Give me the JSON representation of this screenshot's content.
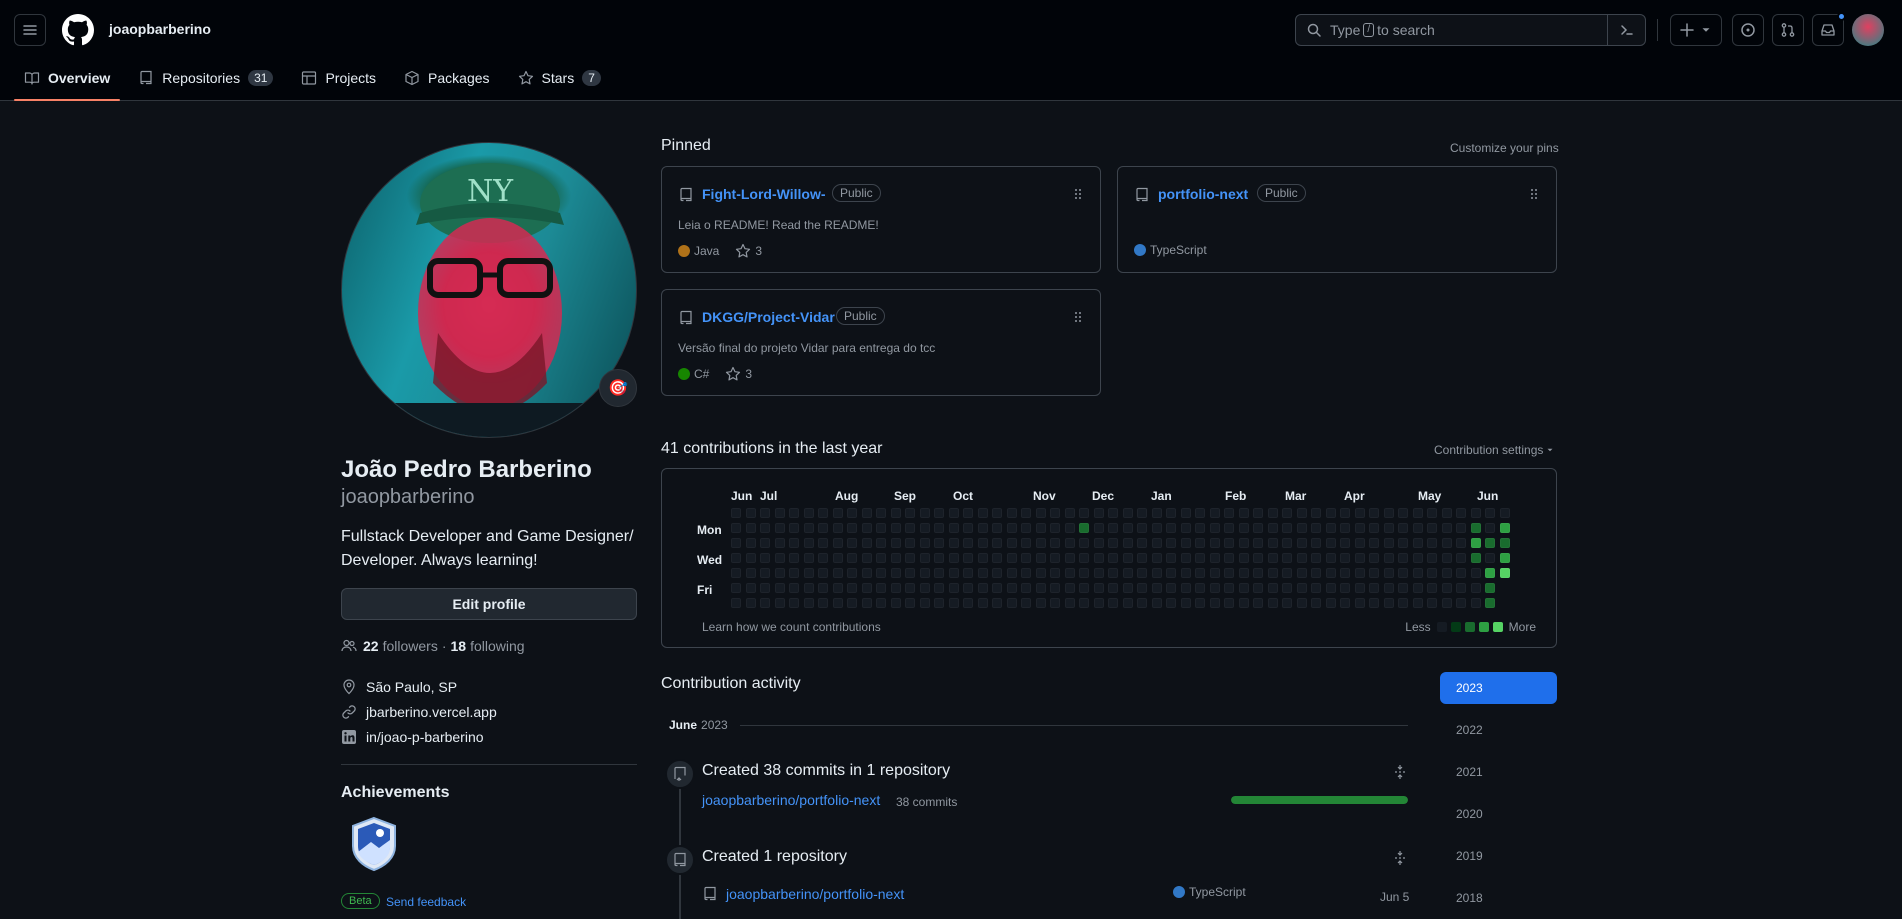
{
  "header": {
    "username": "joaopbarberino",
    "search_before": "Type",
    "search_key": "/",
    "search_after": "to search"
  },
  "tabs": [
    {
      "label": "Overview",
      "icon": "book-icon",
      "active": true
    },
    {
      "label": "Repositories",
      "count": "31",
      "icon": "repo-icon"
    },
    {
      "label": "Projects",
      "icon": "table-icon"
    },
    {
      "label": "Packages",
      "icon": "package-icon"
    },
    {
      "label": "Stars",
      "count": "7",
      "icon": "star-icon"
    }
  ],
  "profile": {
    "name": "João Pedro Barberino",
    "login": "joaopbarberino",
    "bio": "Fullstack Developer and Game Designer/ Developer. Always learning!",
    "edit_label": "Edit profile",
    "followers": "22",
    "followers_label": "followers",
    "sep": "·",
    "following": "18",
    "following_label": "following",
    "location": "São Paulo, SP",
    "website": "jbarberino.vercel.app",
    "linkedin": "in/joao-p-barberino",
    "status_emoji": "🎯"
  },
  "achievements": {
    "title": "Achievements",
    "beta": "Beta",
    "feedback": "Send feedback"
  },
  "pinned": {
    "title": "Pinned",
    "customize": "Customize your pins",
    "repos": [
      {
        "name": "Fight-Lord-Willow-",
        "visibility": "Public",
        "description": "Leia o README! Read the README!",
        "language": "Java",
        "lang_color": "#b07219",
        "stars": "3"
      },
      {
        "name": "portfolio-next",
        "visibility": "Public",
        "description": "",
        "language": "TypeScript",
        "lang_color": "#3178c6",
        "stars": ""
      },
      {
        "name": "DKGG/Project-Vidar",
        "visibility": "Public",
        "description": "Versão final do projeto Vidar para entrega do tcc",
        "language": "C#",
        "lang_color": "#178600",
        "stars": "3"
      }
    ]
  },
  "contributions": {
    "title": "41 contributions in the last year",
    "settings": "Contribution settings",
    "months": [
      "Jun",
      "Jul",
      "Aug",
      "Sep",
      "Oct",
      "Nov",
      "Dec",
      "Jan",
      "Feb",
      "Mar",
      "Apr",
      "May",
      "Jun"
    ],
    "days": [
      "Mon",
      "Wed",
      "Fri"
    ],
    "learn": "Learn how we count contributions",
    "less": "Less",
    "more": "More",
    "levels": [
      "#151b23",
      "#033a16",
      "#196c2e",
      "#2ea043",
      "#56d364"
    ],
    "active_cells": [
      {
        "week": 24,
        "day": 1,
        "level": 2
      },
      {
        "week": 51,
        "day": 1,
        "level": 2
      },
      {
        "week": 51,
        "day": 2,
        "level": 3
      },
      {
        "week": 51,
        "day": 3,
        "level": 2
      },
      {
        "week": 52,
        "day": 2,
        "level": 2
      },
      {
        "week": 52,
        "day": 4,
        "level": 3
      },
      {
        "week": 52,
        "day": 5,
        "level": 2
      },
      {
        "week": 52,
        "day": 6,
        "level": 2
      },
      {
        "week": 53,
        "day": 1,
        "level": 3
      },
      {
        "week": 53,
        "day": 2,
        "level": 2
      },
      {
        "week": 53,
        "day": 3,
        "level": 3
      },
      {
        "week": 53,
        "day": 4,
        "level": 4
      }
    ]
  },
  "activity": {
    "title": "Contribution activity",
    "month": "June",
    "year": "2023",
    "item1_title": "Created 38 commits in 1 repository",
    "item1_repo": "joaopbarberino/portfolio-next",
    "item1_commits": "38 commits",
    "item1_progress": 1.0,
    "item2_title": "Created 1 repository",
    "item2_repo": "joaopbarberino/portfolio-next",
    "item2_lang": "TypeScript",
    "item2_date": "Jun 5"
  },
  "years": [
    "2023",
    "2022",
    "2021",
    "2020",
    "2019",
    "2018"
  ]
}
